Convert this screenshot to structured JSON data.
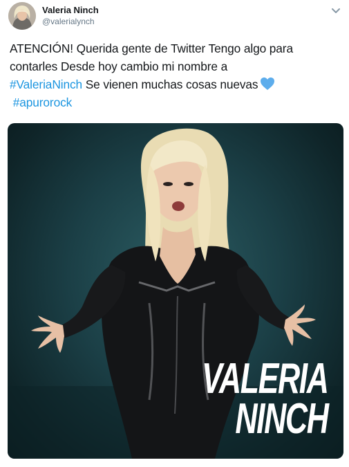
{
  "user": {
    "display_name": "Valeria Ninch",
    "handle": "@valerialynch",
    "avatar_icon": "profile-photo"
  },
  "menu": {
    "icon": "chevron-down-icon"
  },
  "tweet": {
    "line1": "ATENCIÓN! Querida gente de Twitter Tengo algo para",
    "line2": "contarles  Desde hoy cambio mi nombre a",
    "hashtag1": "#ValeriaNinch",
    "line3_rest": " Se vienen muchas cosas nuevas",
    "hashtag2": "#apurorock",
    "emoji": "blue-heart-icon"
  },
  "media": {
    "overlay_line1": "VALERIA",
    "overlay_line2": "NINCH"
  },
  "colors": {
    "link": "#1b95e0",
    "heart": "#5dadec",
    "image_bg": "#1b3f46"
  }
}
